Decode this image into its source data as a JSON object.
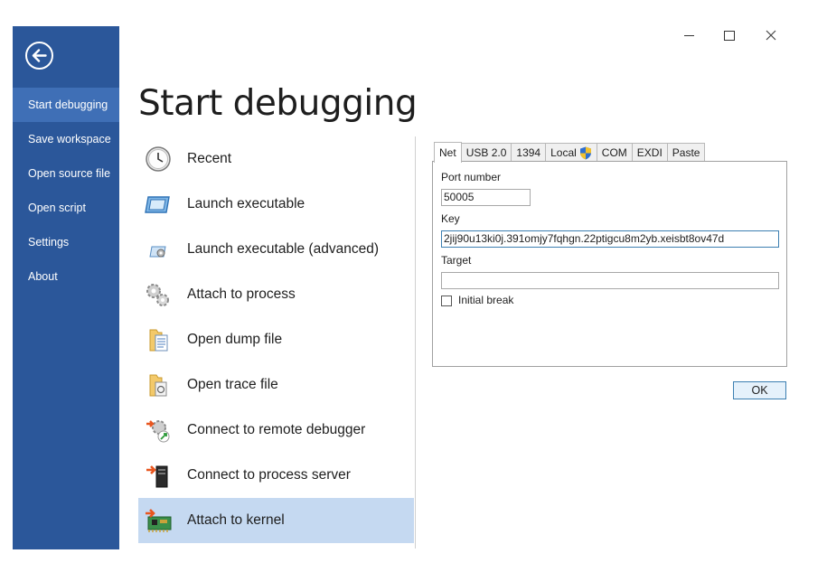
{
  "window": {
    "minimize_glyph": "",
    "close_glyph": "✕"
  },
  "sidebar": {
    "back_icon": "back-arrow-icon",
    "items": [
      {
        "label": "Start debugging",
        "active": true
      },
      {
        "label": "Save workspace",
        "active": false
      },
      {
        "label": "Open source file",
        "active": false
      },
      {
        "label": "Open script",
        "active": false
      },
      {
        "label": "Settings",
        "active": false
      },
      {
        "label": "About",
        "active": false
      }
    ]
  },
  "main": {
    "title": "Start debugging",
    "options": [
      {
        "label": "Recent",
        "icon": "clock-icon"
      },
      {
        "label": "Launch executable",
        "icon": "window-icon"
      },
      {
        "label": "Launch executable (advanced)",
        "icon": "window-gear-icon"
      },
      {
        "label": "Attach to process",
        "icon": "gears-icon"
      },
      {
        "label": "Open dump file",
        "icon": "folder-document-icon"
      },
      {
        "label": "Open trace file",
        "icon": "folder-trace-icon"
      },
      {
        "label": "Connect to remote debugger",
        "icon": "remote-debugger-icon"
      },
      {
        "label": "Connect to process server",
        "icon": "process-server-icon"
      },
      {
        "label": "Attach to kernel",
        "icon": "circuit-board-icon",
        "selected": true
      }
    ]
  },
  "kernel_panel": {
    "tabs": [
      {
        "label": "Net",
        "active": true
      },
      {
        "label": "USB 2.0"
      },
      {
        "label": "1394"
      },
      {
        "label": "Local",
        "icon": "uac-shield-icon"
      },
      {
        "label": "COM"
      },
      {
        "label": "EXDI"
      },
      {
        "label": "Paste"
      }
    ],
    "port_label": "Port number",
    "port_value": "50005",
    "key_label": "Key",
    "key_value": "2jij90u13ki0j.391omjy7fqhgn.22ptigcu8m2yb.xeisbt8ov47d",
    "target_label": "Target",
    "target_value": "",
    "initial_break_label": "Initial break",
    "initial_break_checked": false,
    "ok_label": "OK"
  },
  "colors": {
    "sidebar_bg": "#2b579a",
    "sidebar_active": "#3f6fb6",
    "selected_option": "#c5d9f1",
    "focus_border": "#3c7fb1"
  }
}
